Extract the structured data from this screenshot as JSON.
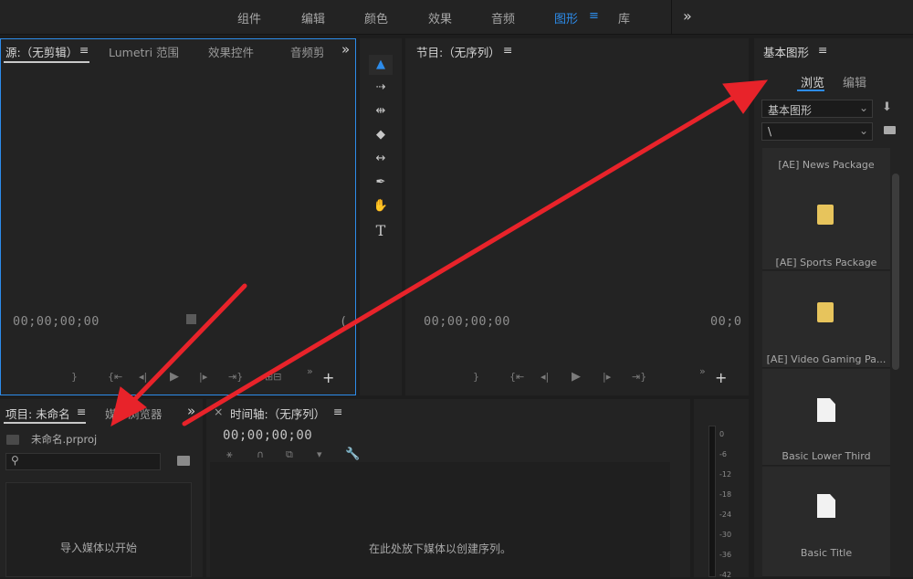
{
  "workspaces": [
    "组件",
    "编辑",
    "颜色",
    "效果",
    "音频",
    "图形",
    "库"
  ],
  "workspace_menu_icon": "≡",
  "more_icon": "»",
  "source_panel": {
    "tabs": [
      "源:（无剪辑）",
      "Lumetri 范围",
      "效果控件",
      "音频剪"
    ],
    "menu": "≡",
    "timecode_left": "00;00;00;00",
    "timecode_right": "("
  },
  "program_panel": {
    "title": "节目:（无序列）",
    "menu": "≡",
    "timecode_left": "00;00;00;00",
    "timecode_right": "00;0"
  },
  "project_panel": {
    "tabs": [
      "项目: 未命名",
      "媒体浏览器"
    ],
    "menu": "≡",
    "file": "未命名.prproj",
    "search_placeholder": "",
    "empty_text": "导入媒体以开始"
  },
  "timeline_panel": {
    "close": "×",
    "title": "时间轴:（无序列）",
    "menu": "≡",
    "timecode": "00;00;00;00",
    "empty_text": "在此处放下媒体以创建序列。"
  },
  "essential_graphics": {
    "title": "基本图形",
    "menu": "≡",
    "tabs": [
      "浏览",
      "编辑"
    ],
    "dropdown1": "基本图形",
    "dropdown2": "\\",
    "items": [
      {
        "label": "[AE] News Package",
        "icon": "folder-icon"
      },
      {
        "label": "[AE] Sports Package",
        "icon": "folder-icon"
      },
      {
        "label": "[AE] Video Gaming Pa...",
        "icon": "document-icon"
      },
      {
        "label": "Basic Lower Third",
        "icon": "document-icon"
      },
      {
        "label": "Basic Title",
        "icon": "document-icon"
      }
    ]
  },
  "audio_meter": {
    "ticks": [
      "0",
      "-6",
      "-12",
      "-18",
      "-24",
      "-30",
      "-36",
      "-42"
    ]
  },
  "colors": {
    "accent": "#2d8ceb",
    "arrow": "#e8232a"
  }
}
